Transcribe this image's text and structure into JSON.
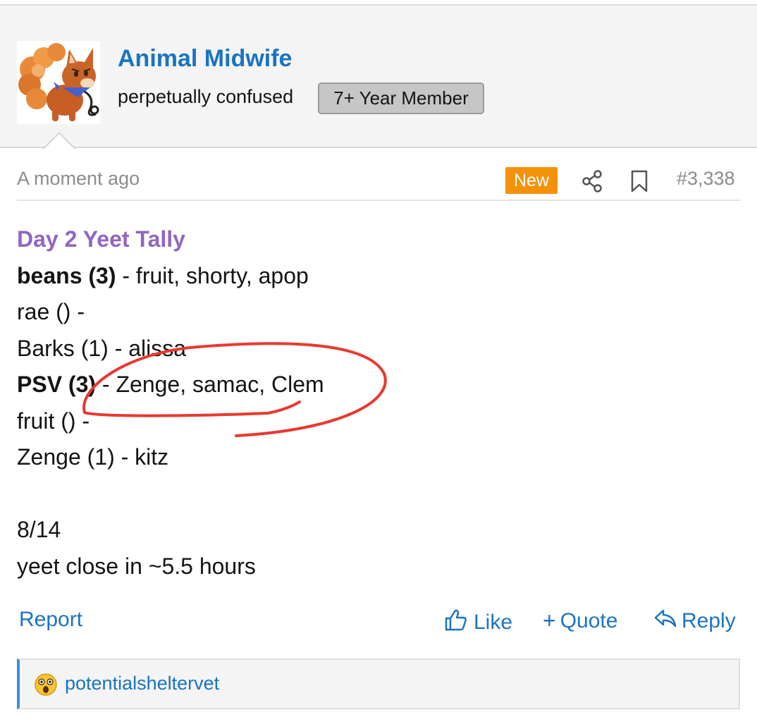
{
  "author": {
    "name": "Animal Midwife",
    "title": "perpetually confused",
    "badge": "7+ Year Member",
    "avatar_icon": "fox-avatar-icon"
  },
  "meta": {
    "timestamp": "A moment ago",
    "new_label": "New",
    "post_number": "#3,338"
  },
  "post": {
    "title": "Day 2 Yeet Tally",
    "lines": [
      {
        "bold": "beans (3)",
        "rest": " - fruit, shorty, apop"
      },
      {
        "bold": "",
        "rest": "rae () -"
      },
      {
        "bold": "",
        "rest": "Barks (1) - alissa"
      },
      {
        "bold": "PSV (3)",
        "rest": " - Zenge, samac, Clem"
      },
      {
        "bold": "",
        "rest": "fruit () -"
      },
      {
        "bold": "",
        "rest": "Zenge (1) - kitz"
      }
    ],
    "count": "8/14",
    "closing": "yeet close in ~5.5 hours"
  },
  "actions": {
    "report": "Report",
    "like": "Like",
    "quote": "Quote",
    "reply": "Reply"
  },
  "reactions": {
    "emoji_icon": "astonished-face-icon",
    "user": "potentialsheltervet"
  },
  "colors": {
    "link_blue": "#1b73c2",
    "title_purple": "#9166c1",
    "new_orange": "#f39208",
    "annotation_red": "#e8392f"
  }
}
